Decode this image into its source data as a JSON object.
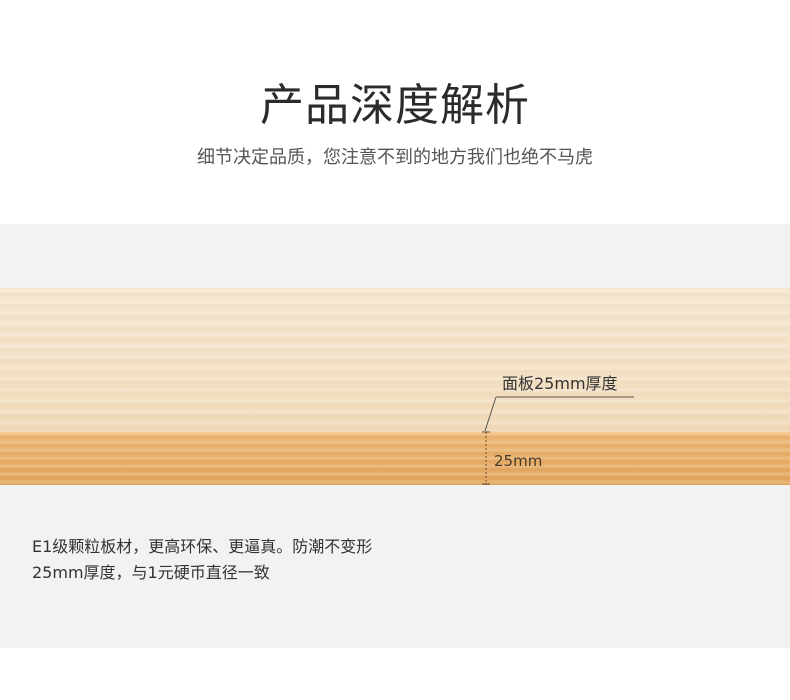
{
  "header": {
    "title": "产品深度解析",
    "subtitle": "细节决定品质，您注意不到的地方我们也绝不马虎"
  },
  "board": {
    "callout_label": "面板25mm厚度",
    "thickness_label": "25mm",
    "colors": {
      "top_surface": "#f3e0c4",
      "edge": "#e8b06d"
    }
  },
  "description": {
    "line1": "E1级颗粒板材，更高环保、更逼真。防潮不变形",
    "line2": "25mm厚度，与1元硬币直径一致"
  }
}
